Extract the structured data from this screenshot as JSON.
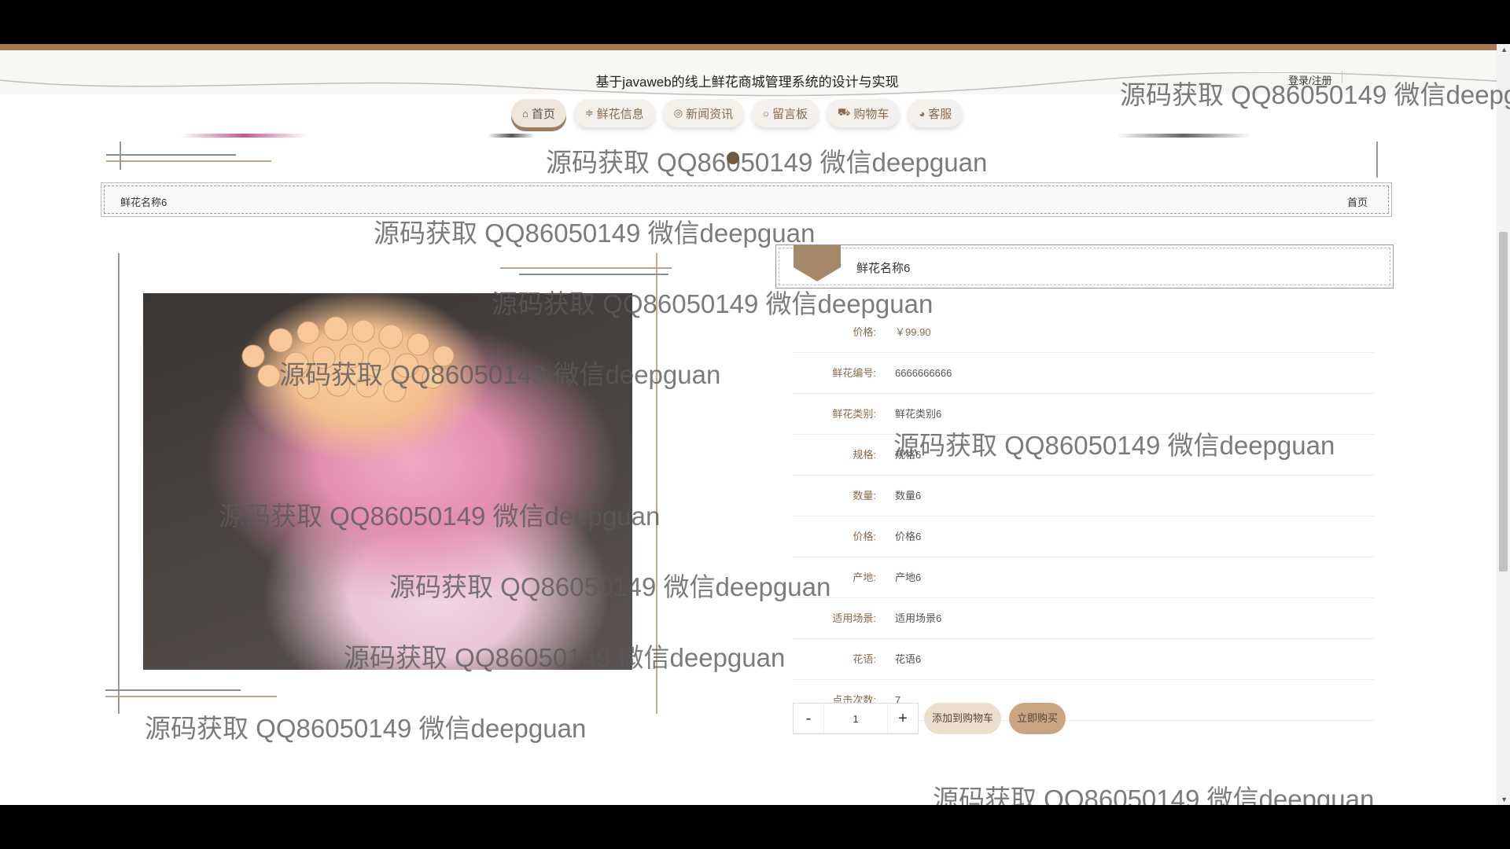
{
  "site": {
    "title": "基于javaweb的线上鲜花商城管理系统的设计与实现",
    "login_label": "登录/注册"
  },
  "nav": {
    "items": [
      {
        "label": "首页",
        "icon": "home-icon",
        "glyph": "⌂",
        "active": true
      },
      {
        "label": "鲜花信息",
        "icon": "sliders-icon",
        "glyph": "≑",
        "active": false
      },
      {
        "label": "新闻资讯",
        "icon": "globe-icon",
        "glyph": "◎",
        "active": false
      },
      {
        "label": "留言板",
        "icon": "speech-bubble-icon",
        "glyph": "○",
        "active": false
      },
      {
        "label": "购物车",
        "icon": "cart-icon",
        "glyph": "⛟",
        "active": false
      },
      {
        "label": "客服",
        "icon": "headset-icon",
        "glyph": "◕",
        "active": false
      }
    ]
  },
  "breadcrumb": {
    "current": "鲜花名称6",
    "home_link": "首页"
  },
  "product": {
    "name": "鲜花名称6",
    "image_alt": "flower-bouquet-photo",
    "details": [
      {
        "label": "价格:",
        "value": "￥99.90",
        "price": true
      },
      {
        "label": "鲜花编号:",
        "value": "6666666666"
      },
      {
        "label": "鲜花类别:",
        "value": "鲜花类别6"
      },
      {
        "label": "规格:",
        "value": "规格6"
      },
      {
        "label": "数量:",
        "value": "数量6"
      },
      {
        "label": "价格:",
        "value": "价格6"
      },
      {
        "label": "产地:",
        "value": "产地6"
      },
      {
        "label": "适用场景:",
        "value": "适用场景6"
      },
      {
        "label": "花语:",
        "value": "花语6"
      },
      {
        "label": "点击次数:",
        "value": "7"
      }
    ]
  },
  "purchase": {
    "minus_label": "-",
    "plus_label": "+",
    "quantity": "1",
    "add_to_cart_label": "添加到购物车",
    "buy_now_label": "立即购买"
  },
  "watermark": {
    "text": "源码获取 QQ86050149 微信deepguan",
    "partial_text": "源码获取 QQ86050149 微信deepgu"
  },
  "colors": {
    "accent_brown": "#a57a4e",
    "label_brown": "#8a6a4a",
    "cart_button": "#ecdfcd",
    "buy_button": "#caa582"
  }
}
